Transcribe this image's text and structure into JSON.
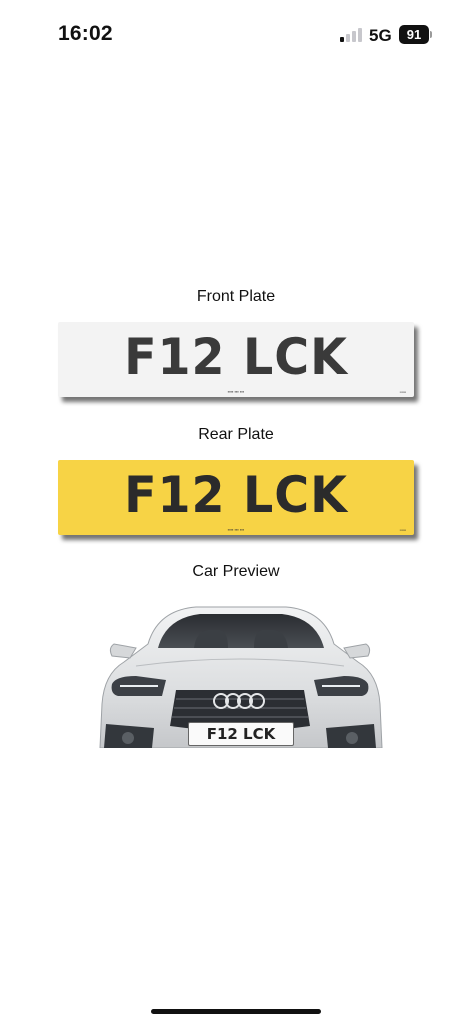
{
  "status_bar": {
    "time": "16:02",
    "network": "5G",
    "battery": "91",
    "icons": [
      "signal-icon",
      "battery-icon"
    ]
  },
  "sections": {
    "front_title": "Front Plate",
    "rear_title": "Rear Plate",
    "car_title": "Car Preview"
  },
  "plates": {
    "registration": "F12 LCK",
    "front_color": "#f3f3f3",
    "rear_color": "#f7d345"
  },
  "car": {
    "plate_text": "F12 LCK",
    "body_color": "#e6e7e9"
  }
}
